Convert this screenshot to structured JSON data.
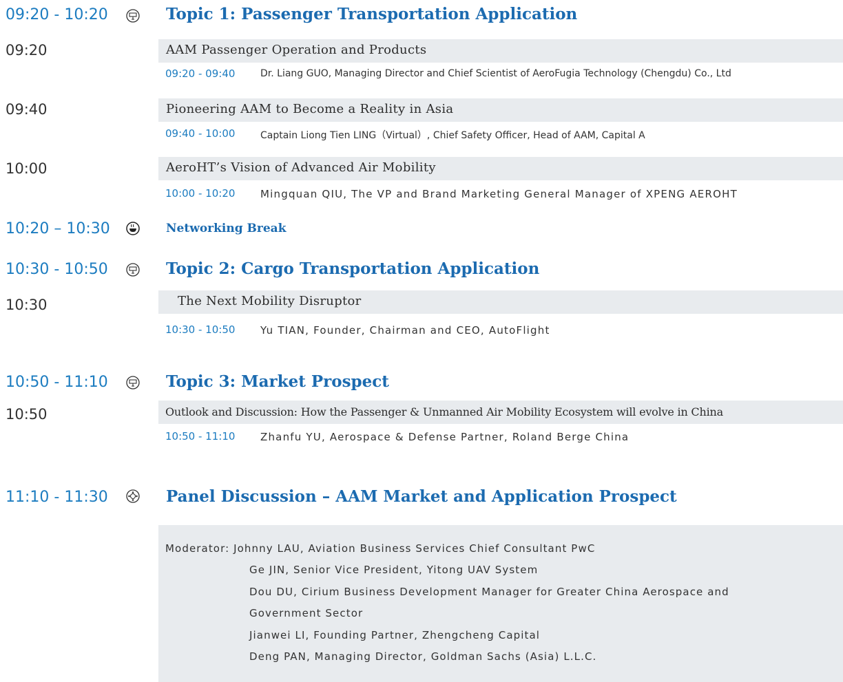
{
  "topic1": {
    "time": "09:20 - 10:20",
    "title": "Topic 1: Passenger Transportation Application",
    "talks": [
      {
        "slot": "09:20",
        "title": "AAM Passenger Operation and Products",
        "time": "09:20 - 09:40",
        "speaker": "Dr. Liang GUO, Managing Director and Chief Scientist of AeroFugia Technology (Chengdu) Co., Ltd"
      },
      {
        "slot": "09:40",
        "title": "Pioneering AAM to Become a Reality in Asia",
        "time": "09:40 - 10:00",
        "speaker": "Captain Liong Tien LING（Virtual）, Chief Safety Officer, Head of AAM, Capital A"
      },
      {
        "slot": "10:00",
        "title": "AeroHT’s Vision of Advanced Air Mobility",
        "time": "10:00 - 10:20",
        "speaker": "Mingquan QIU, The VP and Brand Marketing General Manager of XPENG AEROHT"
      }
    ]
  },
  "break": {
    "time": "10:20 – 10:30",
    "title": "Networking Break"
  },
  "topic2": {
    "time": "10:30 - 10:50",
    "title": "Topic 2: Cargo Transportation Application",
    "talks": [
      {
        "slot": "10:30",
        "title": "The Next Mobility Disruptor",
        "time": "10:30 - 10:50",
        "speaker": "Yu TIAN, Founder, Chairman and CEO, AutoFlight"
      }
    ]
  },
  "topic3": {
    "time": "10:50 - 11:10",
    "title": "Topic 3: Market Prospect",
    "talks": [
      {
        "slot": "10:50",
        "title": "Outlook and Discussion: How the Passenger & Unmanned Air Mobility Ecosystem will evolve in China",
        "time": "10:50 - 11:10",
        "speaker": "Zhanfu YU, Aerospace & Defense Partner, Roland Berge China"
      }
    ]
  },
  "panel": {
    "time": "11:10 - 11:30",
    "title": "Panel Discussion – AAM Market and Application Prospect",
    "moderator": "Moderator: Johnny LAU, Aviation Business Services Chief Consultant PwC",
    "panelists": [
      "Ge JIN, Senior Vice President, Yitong UAV System",
      "Dou DU, Cirium Business Development Manager for Greater China Aerospace and",
      "Government Sector",
      "Jianwei LI, Founding Partner, Zhengcheng Capital",
      "Deng PAN, Managing Director, Goldman Sachs (Asia) L.L.C."
    ]
  },
  "icons": {
    "topic": "presentation-screen-icon",
    "break": "coffee-cup-icon",
    "panel": "round-table-icon"
  },
  "colors": {
    "accent": "#1c7cc0",
    "title": "#1c6bb0",
    "bar": "#e8ebee"
  }
}
